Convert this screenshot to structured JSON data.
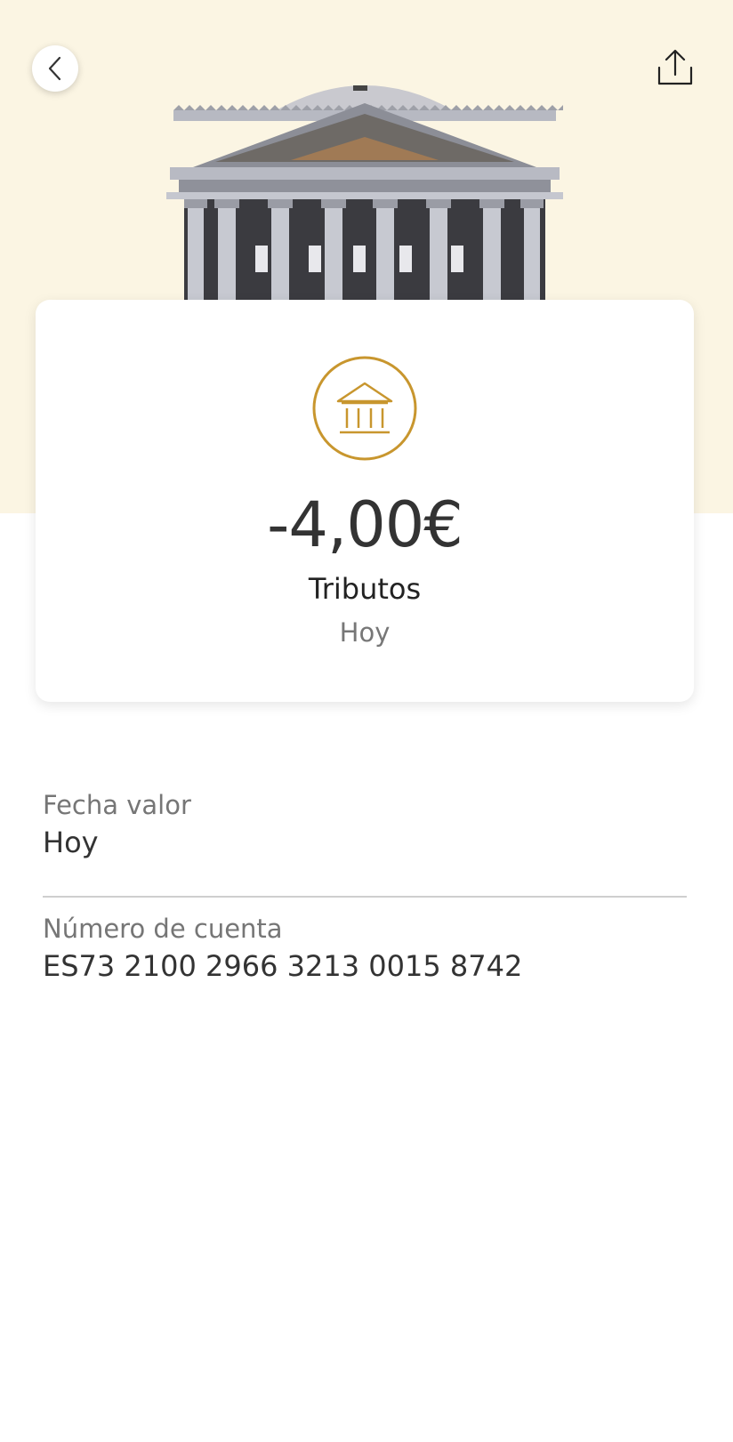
{
  "header": {
    "back_icon": "chevron-left-icon",
    "share_icon": "share-upload-icon",
    "hero_image": "bank-building-facade",
    "hero_background": "#fbf5e3"
  },
  "transaction": {
    "category_icon": "bank-icon",
    "accent_color": "#c8962e",
    "amount": "-4,00€",
    "concept": "Tributos",
    "date": "Hoy"
  },
  "details": [
    {
      "label": "Fecha valor",
      "value": "Hoy"
    },
    {
      "label": "Número de cuenta",
      "value": "ES73 2100 2966 3213 0015 8742"
    }
  ]
}
